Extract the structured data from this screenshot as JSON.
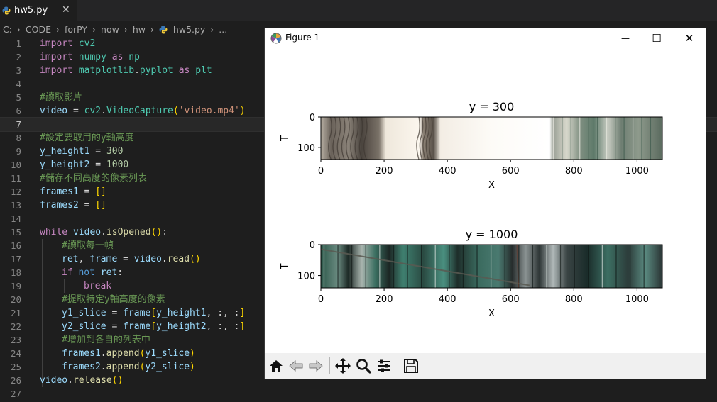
{
  "tab": {
    "filename": "hw5.py",
    "close_glyph": "✕",
    "icon": "python-file-icon"
  },
  "breadcrumb": {
    "parts": [
      "C:",
      "CODE",
      "forPY",
      "now",
      "hw"
    ],
    "file": "hw5.py",
    "ellipsis": "..."
  },
  "editor": {
    "current_line": 7,
    "line_numbers": [
      "1",
      "2",
      "3",
      "4",
      "5",
      "6",
      "7",
      "8",
      "9",
      "10",
      "11",
      "12",
      "13",
      "14",
      "15",
      "16",
      "17",
      "18",
      "19",
      "20",
      "21",
      "22",
      "23",
      "24",
      "25",
      "26",
      "27"
    ],
    "code": {
      "l1": "import cv2",
      "l2": "import numpy as np",
      "l3": "import matplotlib.pyplot as plt",
      "l5": "#讀取影片",
      "l6": "video = cv2.VideoCapture('video.mp4')",
      "l8": "#設定要取用的y軸高度",
      "l9": "y_height1 = 300",
      "l10": "y_height2 = 1000",
      "l11": "#儲存不同高度的像素列表",
      "l12": "frames1 = []",
      "l13": "frames2 = []",
      "l15": "while video.isOpened():",
      "l16": "#讀取每一幀",
      "l17": "ret, frame = video.read()",
      "l18": "if not ret:",
      "l19": "break",
      "l20": "#提取特定y軸高度的像素",
      "l21": "y1_slice = frame[y_height1, :, :]",
      "l22": "y2_slice = frame[y_height2, :, :]",
      "l23": "#增加到各自的列表中",
      "l24": "frames1.append(y1_slice)",
      "l25": "frames2.append(y2_slice)",
      "l26": "video.release()"
    }
  },
  "figure_window": {
    "title": "Figure 1",
    "controls": {
      "minimize": "—",
      "maximize": "☐",
      "close": "✕"
    },
    "toolbar": [
      "home-icon",
      "back-arrow-icon",
      "forward-arrow-icon",
      "pan-icon",
      "zoom-icon",
      "configure-subplots-icon",
      "save-icon"
    ]
  },
  "chart_data": [
    {
      "type": "heatmap",
      "title": "y = 300",
      "xlabel": "X",
      "ylabel": "T",
      "xticks": [
        0,
        200,
        400,
        600,
        800,
        1000
      ],
      "yticks": [
        0,
        100
      ],
      "xlim": [
        0,
        1080
      ],
      "ylim": [
        140,
        0
      ],
      "colors": {
        "light": "#f7f2ea",
        "dark": "#4a4540",
        "green": "#5e7a6a"
      }
    },
    {
      "type": "heatmap",
      "title": "y = 1000",
      "xlabel": "X",
      "ylabel": "T",
      "xticks": [
        0,
        200,
        400,
        600,
        800,
        1000
      ],
      "yticks": [
        0,
        100
      ],
      "xlim": [
        0,
        1080
      ],
      "ylim": [
        140,
        0
      ],
      "colors": {
        "teal": "#3a7a6a",
        "dark": "#1f2a28",
        "gray": "#8a9090"
      }
    }
  ]
}
